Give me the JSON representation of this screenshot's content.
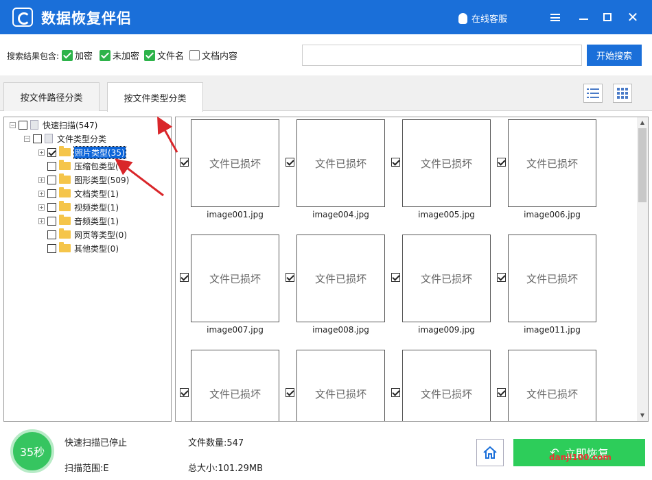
{
  "app": {
    "title": "数据恢复伴侣",
    "support": "在线客服"
  },
  "filter": {
    "label": "搜索结果包含:",
    "options": [
      {
        "label": "加密",
        "checked": true
      },
      {
        "label": "未加密",
        "checked": true
      },
      {
        "label": "文件名",
        "checked": true
      },
      {
        "label": "文档内容",
        "checked": false
      }
    ],
    "search_value": "",
    "search_button": "开始搜索"
  },
  "tabs": [
    {
      "label": "按文件路径分类",
      "active": false
    },
    {
      "label": "按文件类型分类",
      "active": true
    }
  ],
  "tree": [
    {
      "label": "快速扫描(547)",
      "level": 0,
      "expander": "-",
      "checked": false,
      "icon": "doc"
    },
    {
      "label": "文件类型分类",
      "level": 1,
      "expander": "-",
      "checked": false,
      "icon": "doc"
    },
    {
      "label": "照片类型(35)",
      "level": 2,
      "expander": "+",
      "checked": true,
      "icon": "folder",
      "selected": true
    },
    {
      "label": "压缩包类型(0)",
      "level": 2,
      "expander": "",
      "checked": false,
      "icon": "folder"
    },
    {
      "label": "图形类型(509)",
      "level": 2,
      "expander": "+",
      "checked": false,
      "icon": "folder"
    },
    {
      "label": "文档类型(1)",
      "level": 2,
      "expander": "+",
      "checked": false,
      "icon": "folder"
    },
    {
      "label": "视频类型(1)",
      "level": 2,
      "expander": "+",
      "checked": false,
      "icon": "folder"
    },
    {
      "label": "音频类型(1)",
      "level": 2,
      "expander": "+",
      "checked": false,
      "icon": "folder"
    },
    {
      "label": "网页等类型(0)",
      "level": 2,
      "expander": "",
      "checked": false,
      "icon": "folder"
    },
    {
      "label": "其他类型(0)",
      "level": 2,
      "expander": "",
      "checked": false,
      "icon": "folder"
    }
  ],
  "grid": {
    "damaged_text": "文件已损坏",
    "files": [
      "image001.jpg",
      "image004.jpg",
      "image005.jpg",
      "image006.jpg",
      "image007.jpg",
      "image008.jpg",
      "image009.jpg",
      "image011.jpg",
      "",
      "",
      "",
      ""
    ]
  },
  "status": {
    "timer": "35秒",
    "scan_state": "快速扫描已停止",
    "scan_range": "扫描范围:E",
    "file_count": "文件数量:547",
    "total_size": "总大小:101.29MB",
    "recover_button": "立即恢复"
  },
  "watermark": "danji100.com",
  "colors": {
    "primary": "#1a6fd9",
    "green": "#2dcd5a",
    "arrow": "#d9262a"
  }
}
